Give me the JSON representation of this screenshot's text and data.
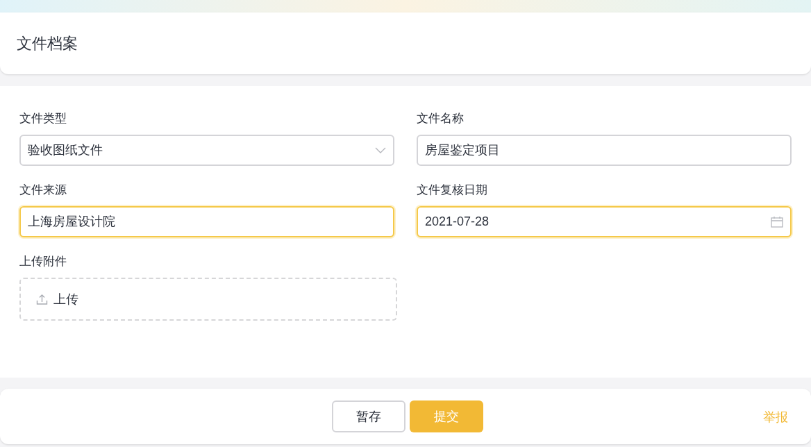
{
  "header": {
    "title": "文件档案"
  },
  "fields": [
    {
      "kind": "select",
      "label": "文件类型",
      "value": "验收图纸文件",
      "focused": false
    },
    {
      "kind": "text",
      "label": "文件名称",
      "value": "房屋鉴定项目",
      "focused": false
    },
    {
      "kind": "text",
      "label": "文件来源",
      "value": "上海房屋设计院",
      "focused": true
    },
    {
      "kind": "date",
      "label": "文件复核日期",
      "value": "2021-07-28",
      "focused": true
    }
  ],
  "upload": {
    "label": "上传附件",
    "button": "上传"
  },
  "footer": {
    "buttons": [
      {
        "label": "暂存",
        "kind": "secondary"
      },
      {
        "label": "提交",
        "kind": "primary"
      }
    ],
    "report_link": "举报"
  }
}
